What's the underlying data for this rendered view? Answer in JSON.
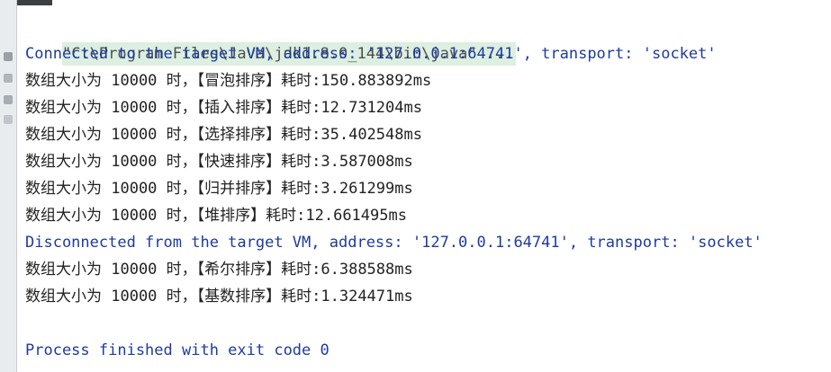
{
  "console": {
    "command": "\"C:\\Program Files\\Java\\jdk1.8.0_144\\bin\\java\" ...",
    "connected": "Connected to the target VM, address: '127.0.0.1:64741', transport: 'socket'",
    "results_before": [
      "数组大小为 10000 时，【冒泡排序】耗时:150.883892ms",
      "数组大小为 10000 时，【插入排序】耗时:12.731204ms",
      "数组大小为 10000 时，【选择排序】耗时:35.402548ms",
      "数组大小为 10000 时，【快速排序】耗时:3.587008ms",
      "数组大小为 10000 时，【归并排序】耗时:3.261299ms",
      "数组大小为 10000 时，【堆排序】耗时:12.661495ms"
    ],
    "disconnected": "Disconnected from the target VM, address: '127.0.0.1:64741', transport: 'socket'",
    "results_after": [
      "数组大小为 10000 时，【希尔排序】耗时:6.388588ms",
      "数组大小为 10000 时，【基数排序】耗时:1.324471ms"
    ],
    "finished": "Process finished with exit code 0"
  },
  "colors": {
    "info": "#1f3b9d",
    "output": "#222222",
    "command_bg": "#dcefe0"
  },
  "icons": {
    "left_gutter": "console-gutter-icons"
  }
}
